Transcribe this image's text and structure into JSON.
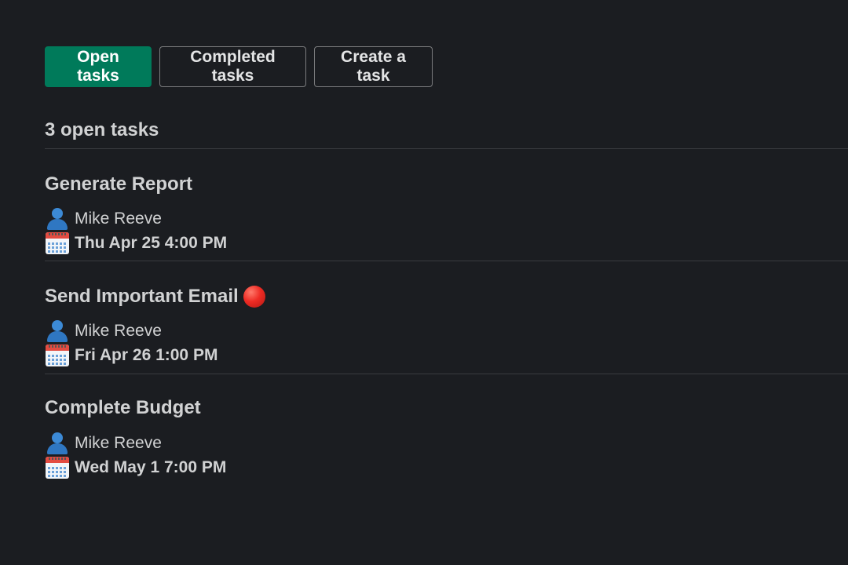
{
  "tabs": {
    "open": "Open tasks",
    "completed": "Completed tasks",
    "create": "Create a task"
  },
  "summary": "3 open tasks",
  "tasks": [
    {
      "title": "Generate Report",
      "assignee": "Mike Reeve",
      "due": "Thu Apr 25 4:00 PM",
      "urgent": false
    },
    {
      "title": "Send Important Email",
      "assignee": "Mike Reeve",
      "due": "Fri Apr 26 1:00 PM",
      "urgent": true,
      "urgent_icon": "red-circle-icon"
    },
    {
      "title": "Complete Budget",
      "assignee": "Mike Reeve",
      "due": "Wed May 1 7:00 PM",
      "urgent": false
    }
  ],
  "icons": {
    "assignee": "person-icon",
    "due": "calendar-icon"
  },
  "colors": {
    "background": "#1b1d21",
    "active_tab": "#007a5a",
    "text": "#d1d2d3",
    "divider": "#3a3c40",
    "urgent": "#ee2b24"
  }
}
